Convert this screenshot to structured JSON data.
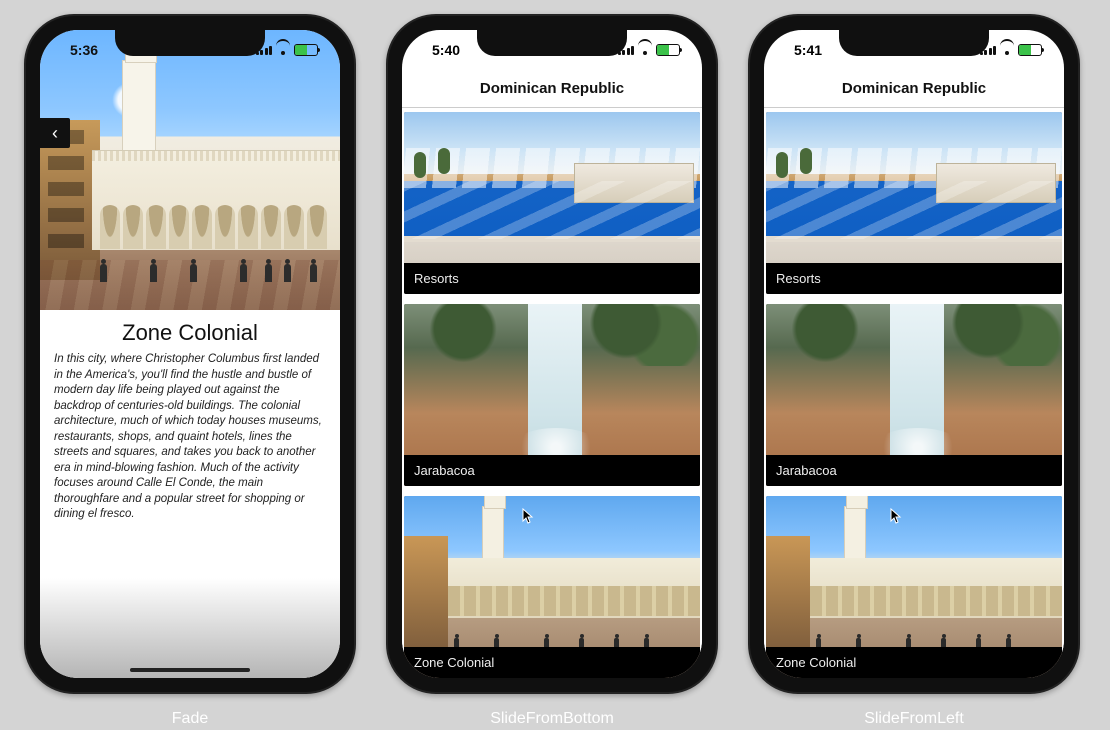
{
  "phone1": {
    "status_time": "5:36",
    "detail_title": "Zone Colonial",
    "detail_desc": "In this city, where Christopher Columbus first landed in the America's, you'll find the hustle and bustle of modern day life being played out against the backdrop of centuries-old buildings. The colonial architecture, much of which today houses museums, restaurants, shops, and quaint hotels, lines the streets and squares, and takes you back to another era in mind-blowing fashion. Much of the activity focuses around Calle El Conde, the main thoroughfare and a popular street for shopping or dining el fresco.",
    "back_glyph": "‹",
    "caption": "Fade"
  },
  "phone2": {
    "status_time": "5:40",
    "nav_title": "Dominican Republic",
    "cards": [
      {
        "label": "Resorts"
      },
      {
        "label": "Jarabacoa"
      },
      {
        "label": "Zone Colonial"
      }
    ],
    "caption": "SlideFromBottom"
  },
  "phone3": {
    "status_time": "5:41",
    "nav_title": "Dominican Republic",
    "cards": [
      {
        "label": "Resorts"
      },
      {
        "label": "Jarabacoa"
      },
      {
        "label": "Zone Colonial"
      }
    ],
    "caption": "SlideFromLeft"
  }
}
